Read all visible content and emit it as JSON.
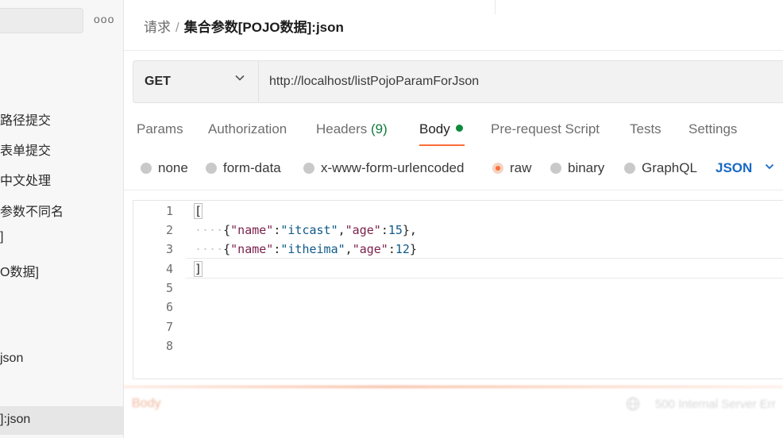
{
  "sidebar": {
    "more_icon": "ooo",
    "items": [
      {
        "label": "路径提交"
      },
      {
        "label": "表单提交"
      },
      {
        "label": "中文处理"
      },
      {
        "label": "参数不同名"
      },
      {
        "label": "]"
      },
      {
        "label": "O数据]"
      },
      {
        "label": "json"
      },
      {
        "label": "]:json"
      }
    ]
  },
  "breadcrumb": {
    "parent": "请求",
    "separator": "/",
    "current": "集合参数[POJO数据]:json"
  },
  "request": {
    "method": "GET",
    "url": "http://localhost/listPojoParamForJson"
  },
  "tabs": {
    "params": "Params",
    "authorization": "Authorization",
    "headers": "Headers",
    "headers_count": "(9)",
    "body": "Body",
    "prerequest": "Pre-request Script",
    "tests": "Tests",
    "settings": "Settings"
  },
  "body_options": {
    "none": "none",
    "form_data": "form-data",
    "urlencoded": "x-www-form-urlencoded",
    "raw": "raw",
    "binary": "binary",
    "graphql": "GraphQL",
    "format": "JSON",
    "selected": "raw"
  },
  "editor": {
    "line_numbers": [
      "1",
      "2",
      "3",
      "4",
      "5",
      "6",
      "7",
      "8"
    ],
    "line1": "[",
    "line2": {
      "indent": "····",
      "open": "{",
      "k1": "\"name\"",
      "c1": ":",
      "v1": "\"itcast\"",
      "comma": ",",
      "k2": "\"age\"",
      "c2": ":",
      "v2": "15",
      "close": "},"
    },
    "line3": {
      "indent": "····",
      "open": "{",
      "k1": "\"name\"",
      "c1": ":",
      "v1": "\"itheima\"",
      "comma": ",",
      "k2": "\"age\"",
      "c2": ":",
      "v2": "12",
      "close": "}"
    },
    "line4": "]"
  },
  "response": {
    "body_tab": "Body",
    "status": "500 Internal Server Err"
  },
  "colors": {
    "accent": "#ff6c37",
    "link": "#1769c5",
    "success": "#0c8a3e"
  }
}
